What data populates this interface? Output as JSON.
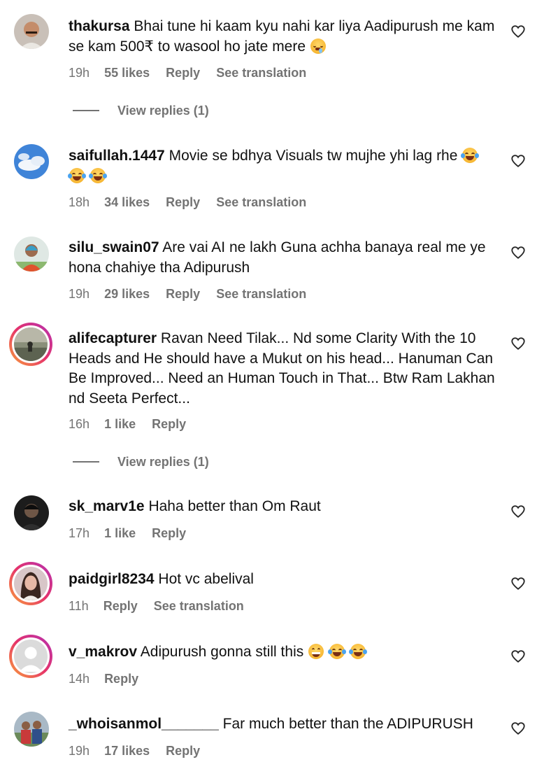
{
  "colors": {
    "meta": "#737373",
    "text": "#111111",
    "story_ring_start": "#f9a23a",
    "story_ring_end": "#b430b3"
  },
  "actions": {
    "reply": "Reply",
    "see_translation": "See translation",
    "view_replies": "View replies (1)"
  },
  "comments": [
    {
      "username": "thakursa",
      "text": "Bhai tune hi kaam kyu nahi kar liya Aadipurush me kam se kam 500₹ to wasool ho jate mere",
      "emoji": "drooling-face-icon",
      "time": "19h",
      "likes": "55 likes",
      "has_translation": true,
      "view_replies": true
    },
    {
      "username": "saifullah.1447",
      "text": "Movie se bdhya Visuals tw mujhe yhi lag rhe",
      "emoji": "tears-of-joy-icon x3",
      "time": "18h",
      "likes": "34 likes",
      "has_translation": true
    },
    {
      "username": "silu_swain07",
      "text": "Are vai AI ne lakh Guna achha banaya real me ye hona chahiye tha Adipurush",
      "time": "19h",
      "likes": "29 likes",
      "has_translation": true
    },
    {
      "username": "alifecapturer",
      "text": "Ravan Need Tilak... Nd some Clarity With the 10 Heads and He should have a Mukut on his head... Hanuman Can Be Improved... Need an Human Touch in That... Btw Ram Lakhan nd Seeta Perfect...",
      "time": "16h",
      "likes": "1 like",
      "has_translation": false,
      "view_replies": true
    },
    {
      "username": "sk_marv1e",
      "text": "Haha better than Om Raut",
      "time": "17h",
      "likes": "1 like",
      "has_translation": false
    },
    {
      "username": "paidgirl8234",
      "text": "Hot vc abelival",
      "time": "11h",
      "likes": "",
      "has_translation": true
    },
    {
      "username": "v_makrov",
      "text": "Adipurush gonna still this",
      "emoji": "grinning-face-icon, tears-of-joy-icon x2",
      "time": "14h",
      "likes": "",
      "has_translation": false
    },
    {
      "username": "_whoisanmol_______",
      "text": "Far much better than the ADIPURUSH",
      "time": "19h",
      "likes": "17 likes",
      "has_translation": false
    }
  ]
}
